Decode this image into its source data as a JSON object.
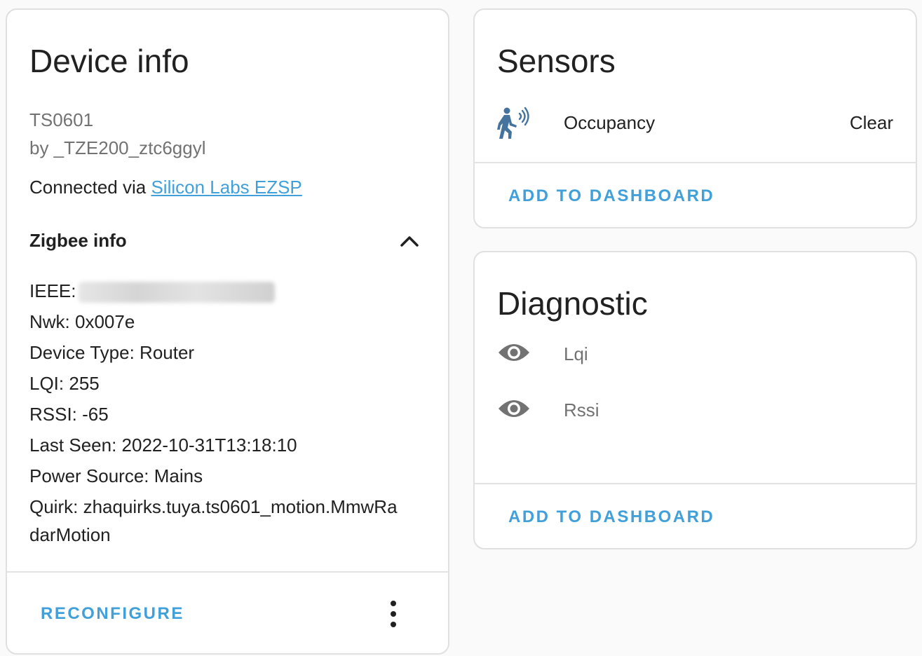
{
  "device_info": {
    "title": "Device info",
    "model": "TS0601",
    "manufacturer": "by _TZE200_ztc6ggyl",
    "connected_via_prefix": "Connected via ",
    "connected_via_link": "Silicon Labs EZSP",
    "zigbee_info_header": "Zigbee info",
    "ieee_label": "IEEE:",
    "nwk": "Nwk: 0x007e",
    "device_type": "Device Type: Router",
    "lqi": "LQI: 255",
    "rssi": "RSSI: -65",
    "last_seen": "Last Seen: 2022-10-31T13:18:10",
    "power_source": "Power Source: Mains",
    "quirk_line1": "Quirk: zhaquirks.tuya.ts0601_motion.MmwRa",
    "quirk_line2": "darMotion",
    "reconfigure_label": "RECONFIGURE"
  },
  "sensors": {
    "title": "Sensors",
    "items": [
      {
        "label": "Occupancy",
        "state": "Clear",
        "icon": "motion-sensor-icon"
      }
    ],
    "add_to_dashboard_label": "ADD TO DASHBOARD"
  },
  "diagnostic": {
    "title": "Diagnostic",
    "items": [
      {
        "label": "Lqi",
        "icon": "eye-icon"
      },
      {
        "label": "Rssi",
        "icon": "eye-icon"
      }
    ],
    "add_to_dashboard_label": "ADD TO DASHBOARD"
  },
  "colors": {
    "accent": "#41a0d9",
    "sensor_icon": "#44739e",
    "muted_text": "#727272",
    "card_border": "#e0e0e0"
  }
}
